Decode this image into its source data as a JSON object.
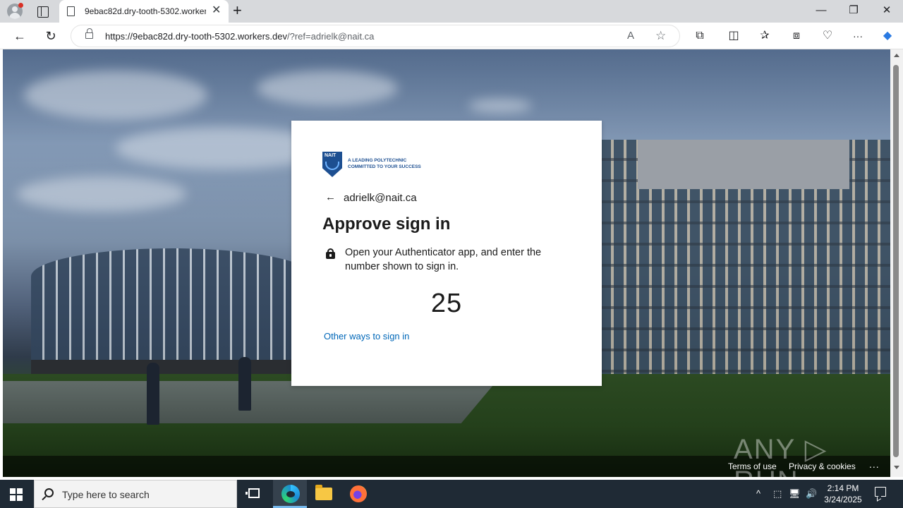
{
  "browser": {
    "tab": {
      "title": "9ebac82d.dry-tooth-5302.worker",
      "favicon": "page-icon",
      "close": "✕"
    },
    "new_tab": "+",
    "window_controls": {
      "minimize": "—",
      "restore": "❐",
      "close": "✕"
    },
    "nav": {
      "back": "←",
      "reload": "↻"
    },
    "address": {
      "protocol": "https://",
      "domain": "9ebac82d.dry-tooth-5302.workers.dev",
      "path": "/?ref=adrielk@nait.ca"
    },
    "omnibox_icons": {
      "read_aloud": "A",
      "favorite": "☆"
    },
    "toolbar_icons": {
      "extensions": "⧉",
      "split": "◫",
      "favorites": "✰",
      "collections": "⧈",
      "performance": "♡",
      "menu": "···",
      "copilot": "◆"
    }
  },
  "page": {
    "logo": {
      "shield": "NAIT",
      "line1": "A LEADING POLYTECHNIC",
      "line2": "COMMITTED TO YOUR SUCCESS"
    },
    "back_arrow": "←",
    "identity": "adrielk@nait.ca",
    "title": "Approve sign in",
    "instruction": "Open your Authenticator app, and enter the number shown to sign in.",
    "number": "25",
    "other_ways": "Other ways to sign in",
    "footer": {
      "terms": "Terms of use",
      "privacy": "Privacy & cookies",
      "more": "..."
    },
    "watermark": "ANY ▷ RUN"
  },
  "taskbar": {
    "search_placeholder": "Type here to search",
    "tray": {
      "chevron": "^",
      "meet": "⬚",
      "network": "🖥",
      "volume": "🔊"
    },
    "time": "2:14 PM",
    "date": "3/24/2025"
  },
  "colors": {
    "link": "#0067b8",
    "brand": "#1d4f91",
    "taskbar": "#1f2a35"
  }
}
